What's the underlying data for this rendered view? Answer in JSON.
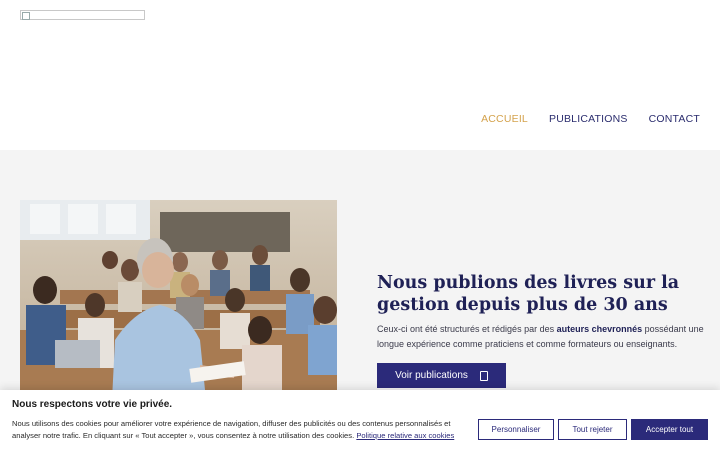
{
  "nav": {
    "items": [
      {
        "label": "ACCUEIL",
        "active": true
      },
      {
        "label": "PUBLICATIONS",
        "active": false
      },
      {
        "label": "CONTACT",
        "active": false
      }
    ]
  },
  "hero": {
    "headline_line1": "Nous publions des livres sur la",
    "headline_line2": "gestion depuis plus de 30 ans",
    "desc_before": "Ceux-ci ont été structurés et rédigés par des ",
    "desc_bold": "auteurs chevronnés",
    "desc_after": " possédant une longue expérience comme praticiens et comme formateurs ou enseignants.",
    "cta_label": "Voir publications",
    "cta_icon": "book-icon"
  },
  "cookie": {
    "title": "Nous respectons votre vie privée.",
    "text": "Nous utilisons des cookies pour améliorer votre expérience de navigation, diffuser des publicités ou des contenus personnalisés et analyser notre trafic. En cliquant sur « Tout accepter », vous consentez à notre utilisation des cookies.",
    "policy_link": "Politique relative aux cookies",
    "customize_label": "Personnaliser",
    "reject_label": "Tout rejeter",
    "accept_label": "Accepter tout"
  },
  "colors": {
    "accent": "#d4a24c",
    "primary": "#2b2a7a",
    "hero_bg": "#f4f4f4"
  }
}
